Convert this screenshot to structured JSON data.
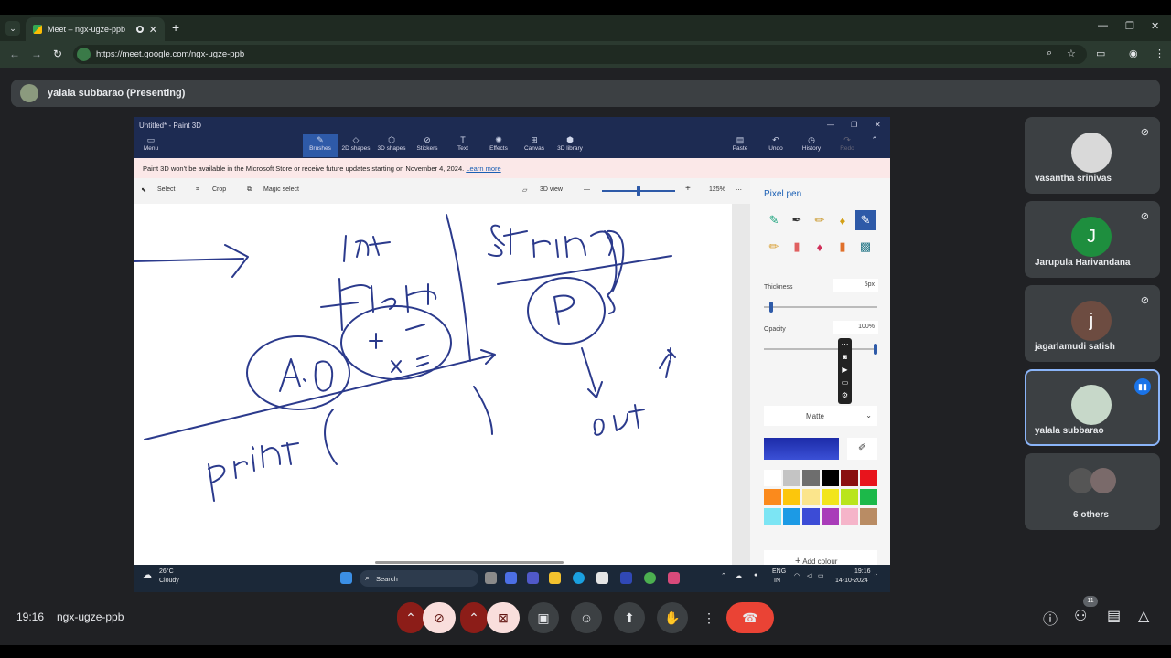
{
  "browser": {
    "tab_title": "Meet – ngx-ugze-ppb",
    "url": "https://meet.google.com/ngx-ugze-ppb"
  },
  "presenter": {
    "name": "yalala subbarao (Presenting)"
  },
  "paint3d": {
    "window_title": "Untitled* - Paint 3D",
    "ribbon": [
      {
        "label": "Menu"
      },
      {
        "label": "Brushes"
      },
      {
        "label": "2D shapes"
      },
      {
        "label": "3D shapes"
      },
      {
        "label": "Stickers"
      },
      {
        "label": "Text"
      },
      {
        "label": "Effects"
      },
      {
        "label": "Canvas"
      },
      {
        "label": "3D library"
      },
      {
        "label": "Paste"
      },
      {
        "label": "Undo"
      },
      {
        "label": "History"
      },
      {
        "label": "Redo"
      }
    ],
    "notice": "Paint 3D won't be available in the Microsoft Store or receive future updates starting on November 4, 2024.",
    "notice_link": "Learn more",
    "tools": {
      "select": "Select",
      "crop": "Crop",
      "magic_select": "Magic select",
      "view3d": "3D view",
      "zoom": "125%"
    },
    "panel": {
      "title": "Pixel pen",
      "thickness_label": "Thickness",
      "thickness_value": "5px",
      "thickness_level": 0.05,
      "opacity_label": "Opacity",
      "opacity_value": "100%",
      "opacity_level": 1.0,
      "finish": "Matte",
      "add_colour": "Add colour",
      "palette": [
        "#ffffff",
        "#c4c4c4",
        "#6e6e6e",
        "#000000",
        "#8a1010",
        "#e8141c",
        "#fb8a1c",
        "#fcc60c",
        "#fbe58c",
        "#f2e51c",
        "#b9e51c",
        "#1cb94a",
        "#7ce5f4",
        "#1c9ae5",
        "#3c4cd6",
        "#a93cb9",
        "#f5b4c9",
        "#b98c64"
      ]
    },
    "handwriting": {
      "words": [
        "Int",
        "Float",
        "String",
        "P",
        "A.O",
        "+ -",
        "x =",
        "out",
        "print"
      ]
    },
    "taskbar": {
      "temperature": "26°C",
      "weather": "Cloudy",
      "search": "Search",
      "lang": "ENG",
      "region": "IN",
      "time": "19:16",
      "date": "14-10-2024"
    }
  },
  "participants": [
    {
      "name": "vasantha srinivas",
      "initial": "",
      "color": "#d9d9d9",
      "muted": true
    },
    {
      "name": "Jarupula Harivandana",
      "initial": "J",
      "color": "#1e8e3e",
      "muted": true
    },
    {
      "name": "jagarlamudi satish",
      "initial": "j",
      "color": "#6d4c41",
      "muted": true
    },
    {
      "name": "yalala subbarao",
      "initial": "",
      "color": "#c7d8c9",
      "muted": false,
      "speaking": true
    },
    {
      "name": "6 others",
      "initial": "",
      "color": "#555",
      "muted": false
    }
  ],
  "bottom": {
    "time": "19:16",
    "meeting_code": "ngx-ugze-ppb",
    "participant_count": "11"
  }
}
